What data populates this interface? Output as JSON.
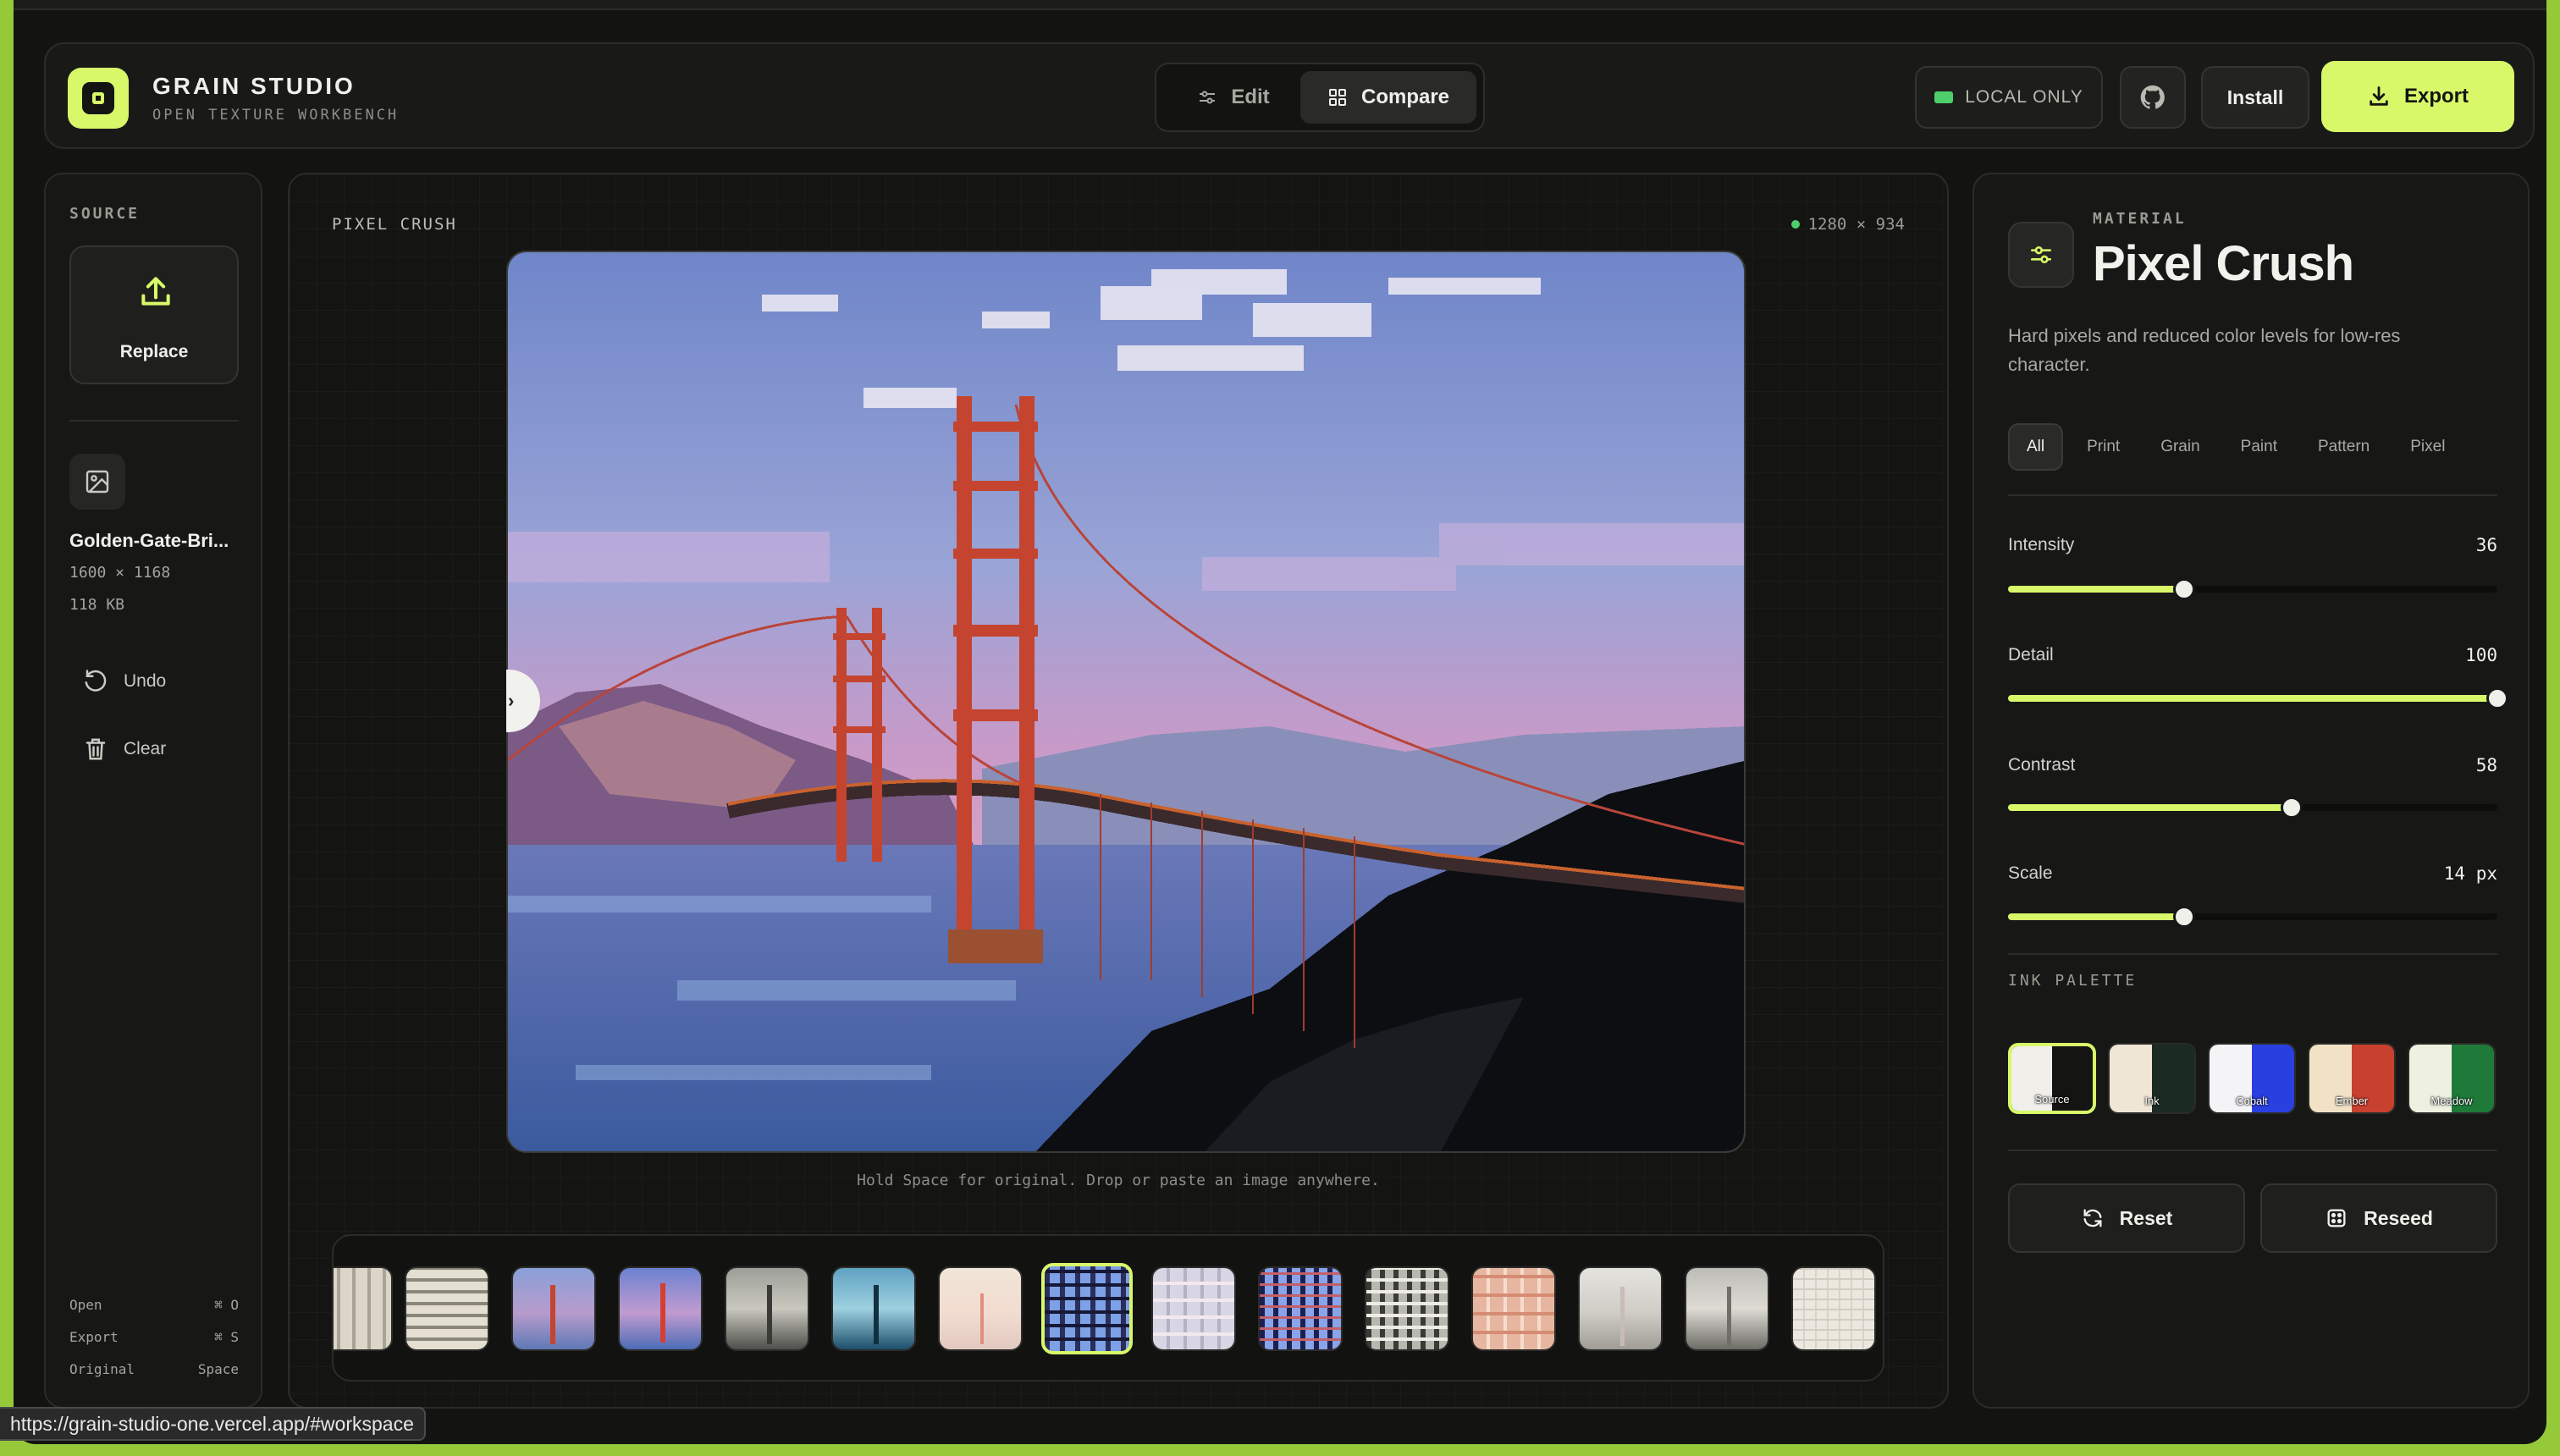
{
  "app": {
    "title": "GRAIN STUDIO",
    "subtitle": "OPEN TEXTURE WORKBENCH"
  },
  "modes": {
    "edit": "Edit",
    "compare": "Compare",
    "active": "Compare"
  },
  "header": {
    "local": "LOCAL ONLY",
    "install": "Install",
    "export": "Export"
  },
  "source": {
    "label": "SOURCE",
    "replace": "Replace",
    "file_name": "Golden-Gate-Bri...",
    "dimensions": "1600 × 1168",
    "size": "118 KB",
    "undo": "Undo",
    "clear": "Clear"
  },
  "shortcuts": [
    {
      "label": "Open",
      "key": "⌘ O"
    },
    {
      "label": "Export",
      "key": "⌘ S"
    },
    {
      "label": "Original",
      "key": "Space"
    }
  ],
  "canvas": {
    "name": "PIXEL CRUSH",
    "output_dims": "1280 × 934",
    "hint": "Hold Space for original. Drop or paste an image anywhere."
  },
  "material": {
    "label": "MATERIAL",
    "title": "Pixel Crush",
    "description": "Hard pixels and reduced color levels for low-res character."
  },
  "filters": [
    "All",
    "Print",
    "Grain",
    "Paint",
    "Pattern",
    "Pixel"
  ],
  "active_filter": "All",
  "sliders": [
    {
      "label": "Intensity",
      "value": "36",
      "fraction": 0.36
    },
    {
      "label": "Detail",
      "value": "100",
      "fraction": 1.0
    },
    {
      "label": "Contrast",
      "value": "58",
      "fraction": 0.58
    },
    {
      "label": "Scale",
      "value": "14 px",
      "fraction": 0.36
    }
  ],
  "ink_palette": {
    "label": "INK PALETTE",
    "swatches": [
      {
        "name": "Source",
        "a": "#f0efea",
        "b": "#141512",
        "selected": true
      },
      {
        "name": "Ink",
        "a": "#efe6d6",
        "b": "#1c2a24",
        "selected": false
      },
      {
        "name": "Cobalt",
        "a": "#f4f4f6",
        "b": "#2a3fe0",
        "selected": false
      },
      {
        "name": "Ember",
        "a": "#f1e2c6",
        "b": "#c8402e",
        "selected": false
      },
      {
        "name": "Meadow",
        "a": "#eef0e0",
        "b": "#1f7a3a",
        "selected": false
      }
    ]
  },
  "actions": {
    "reset": "Reset",
    "reseed": "Reseed"
  },
  "status_url": "https://grain-studio-one.vercel.app/#workspace",
  "colors": {
    "accent": "#d8f86a",
    "background": "#131412",
    "window_border": "#95c93a"
  }
}
